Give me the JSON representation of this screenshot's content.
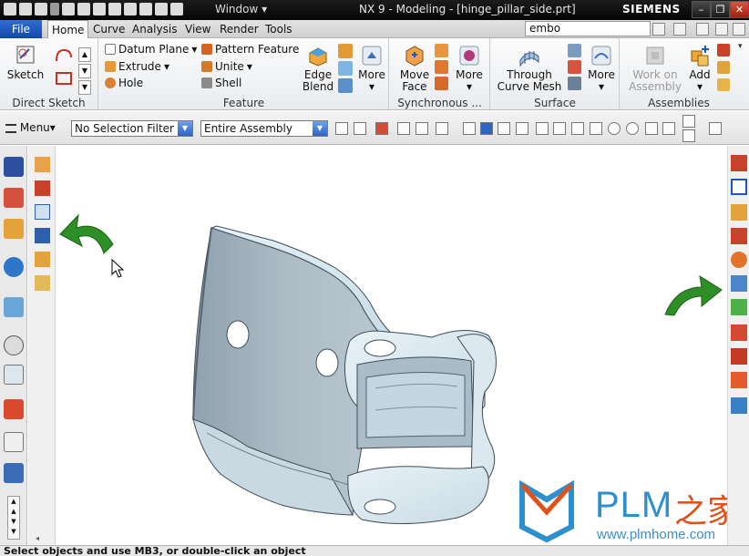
{
  "window": {
    "window_menu": "Window",
    "title": "NX 9 - Modeling - [hinge_pillar_side.prt]",
    "brand": "SIEMENS",
    "buttons": {
      "minimize": "–",
      "restore": "❐",
      "close": "✕"
    }
  },
  "tabs": {
    "file": "File",
    "items": [
      "Home",
      "Curve",
      "Analysis",
      "View",
      "Render",
      "Tools"
    ],
    "active": "Home",
    "command_search": "embo"
  },
  "ribbon": {
    "direct_sketch": {
      "label": "Direct Sketch",
      "sketch": "Sketch"
    },
    "feature": {
      "label": "Feature",
      "datum_plane": "Datum Plane",
      "extrude": "Extrude",
      "hole": "Hole",
      "pattern_feature": "Pattern Feature",
      "unite": "Unite",
      "shell": "Shell",
      "edge_blend_1": "Edge",
      "edge_blend_2": "Blend",
      "more": "More"
    },
    "synchronous": {
      "label": "Synchronous ...",
      "move_face_1": "Move",
      "move_face_2": "Face",
      "more": "More"
    },
    "surface": {
      "label": "Surface",
      "tcm_1": "Through",
      "tcm_2": "Curve Mesh",
      "more": "More"
    },
    "assemblies": {
      "label": "Assemblies",
      "woa_1": "Work on",
      "woa_2": "Assembly",
      "add": "Add"
    }
  },
  "selection_bar": {
    "menu": "Menu",
    "filter": "No Selection Filter",
    "scope": "Entire Assembly"
  },
  "status": "Select objects and use MB3, or double-click an object",
  "watermark": {
    "plm": "PLM",
    "cn": "之家",
    "url": "www.plmhome.com"
  },
  "colors": {
    "accent": "#1f57b8",
    "arrow_green": "#2f8f27",
    "model": "#c6d9e4"
  }
}
